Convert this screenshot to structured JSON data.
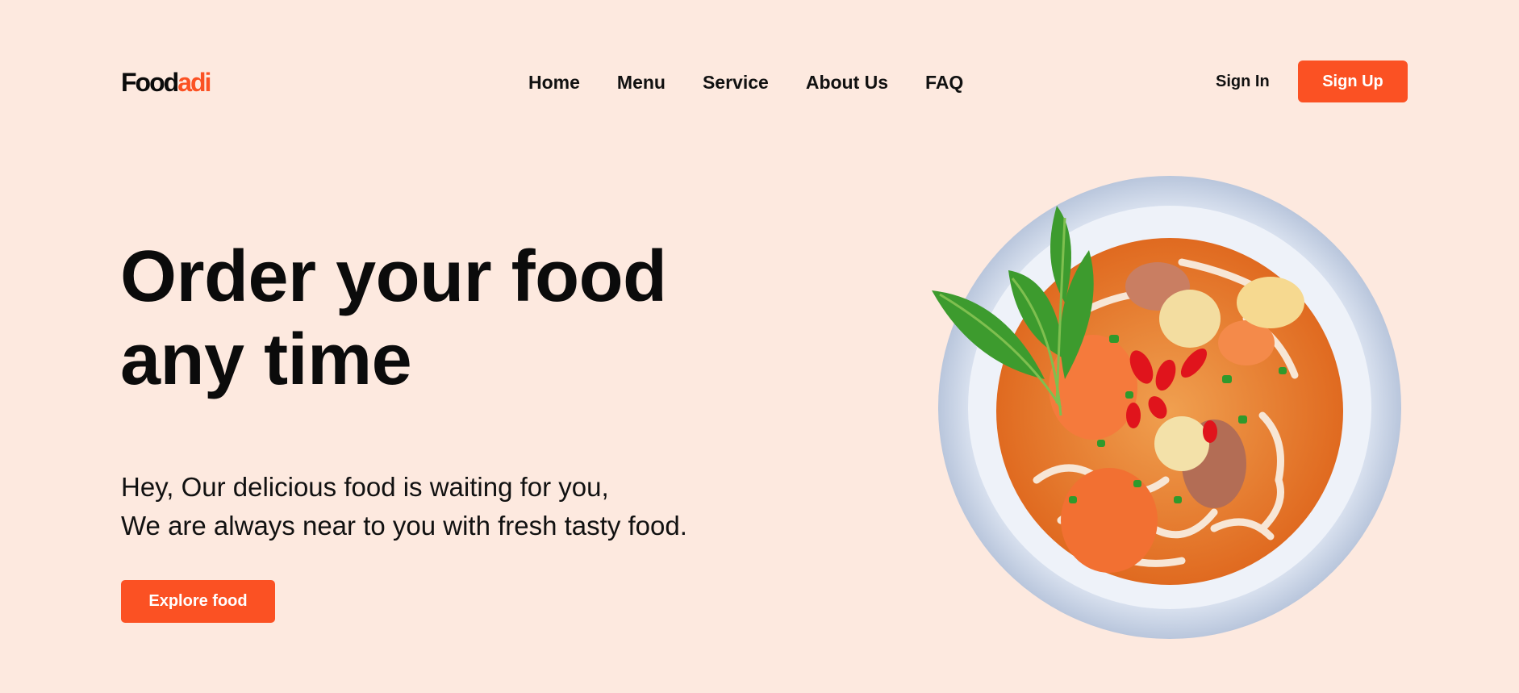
{
  "header": {
    "logo_main": "Food",
    "logo_accent": "adi",
    "nav": [
      "Home",
      "Menu",
      "Service",
      "About Us",
      "FAQ"
    ],
    "signin_label": "Sign In",
    "signup_label": "Sign Up"
  },
  "hero": {
    "headline_line1": "Order your food",
    "headline_line2": "any time",
    "subtitle_line1": "Hey, Our delicious food is waiting for you,",
    "subtitle_line2": "We are always near to you with fresh tasty food.",
    "cta_label": "Explore food"
  },
  "image": {
    "subject": "bowl of noodle soup with shrimp, quail eggs, chili and greens"
  },
  "colors": {
    "background": "#fde9df",
    "accent": "#fb5123",
    "text": "#0b0b0b"
  }
}
